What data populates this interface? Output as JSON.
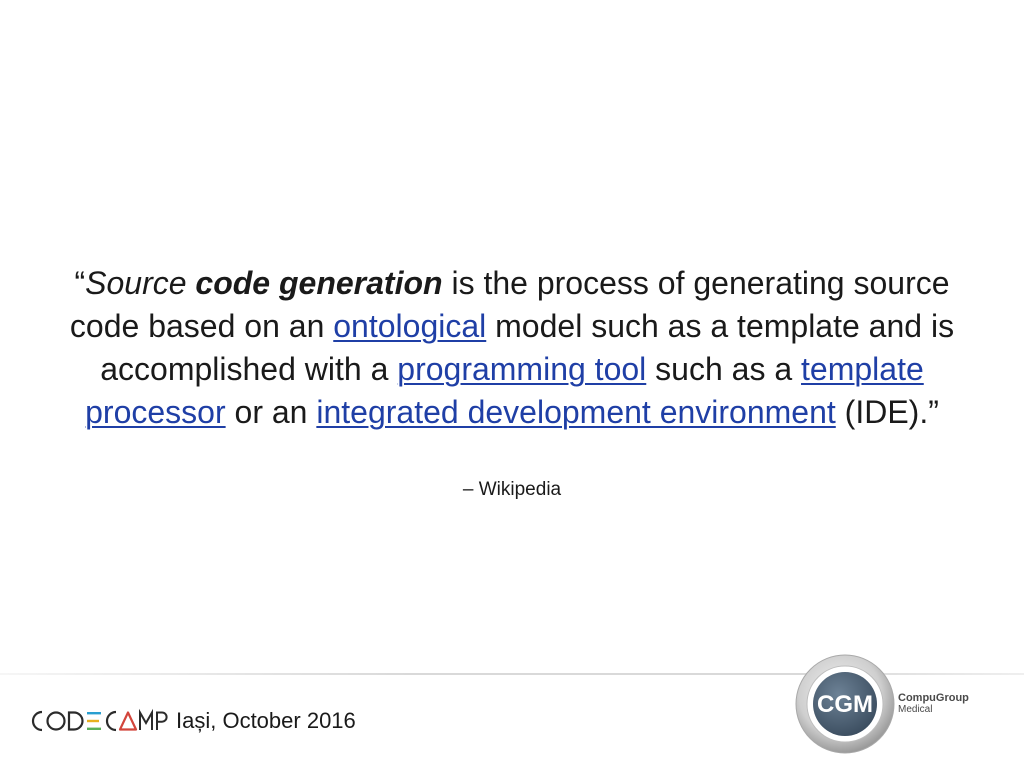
{
  "quote": {
    "open_mark": "“",
    "w_source": "Source",
    "w_code_generation": "code generation",
    "t1": " is the process of generating source code based on an ",
    "link_ontological": "ontological",
    "t2": " model such as a template and is accomplished with a ",
    "link_programming_tool": "programming tool",
    "t3": " such as a ",
    "link_template_processor": "template processor",
    "t4": " or an ",
    "link_ide": "integrated development environment",
    "t5": " (IDE).”"
  },
  "attribution": "– Wikipedia",
  "footer": {
    "logo_text": "CODECAMP",
    "event": "Iași, October 2016",
    "company_logo_text": "CGM",
    "company_name_line1": "CompuGroup",
    "company_name_line2": "Medical"
  },
  "colors": {
    "link": "#1f3fa6",
    "text": "#1a1a1a",
    "cgm_ring": "#b8b8b8",
    "cgm_inner": "#4b5f73"
  }
}
